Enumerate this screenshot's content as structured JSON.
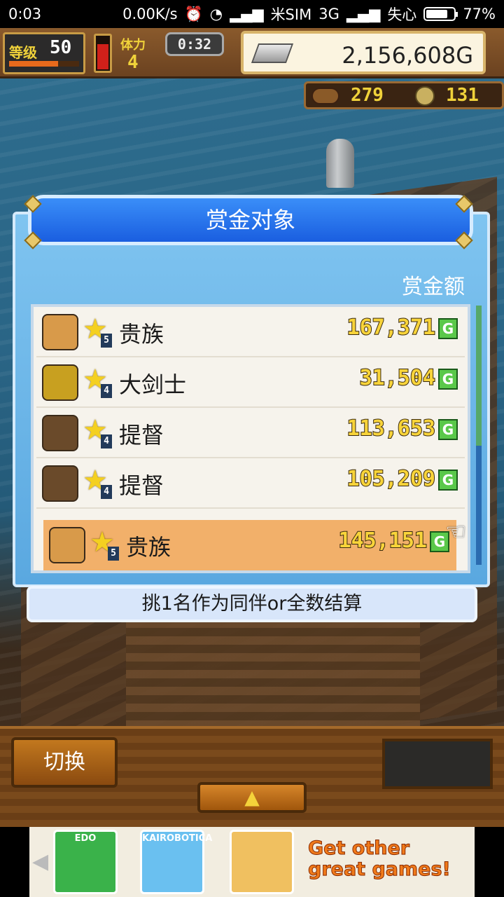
{
  "status_bar": {
    "time": "0:03",
    "network_speed": "0.00K/s",
    "carrier": "米SIM",
    "network_type": "3G",
    "signal_label": "失心",
    "battery_percent": "77%",
    "battery_level": 0.77
  },
  "hud": {
    "level_label": "等级",
    "level_value": "50",
    "level_progress": 0.7,
    "stamina_level": 0.75,
    "stamina_label": "体力",
    "stamina_value": "4",
    "timer": "0:32",
    "gold": "2,156,608G",
    "resource_1": "279",
    "resource_2": "131",
    "gold_icon": "silver-bar-icon",
    "resource_1_icon": "food-icon",
    "resource_2_icon": "coin-icon"
  },
  "dialog": {
    "title": "赏金对象",
    "column_header": "赏金额",
    "hint": "挑1名作为同伴or全数结算",
    "currency_mark": "G",
    "rows": [
      {
        "job": "贵族",
        "rank": "5",
        "bounty": "167,371",
        "selected": false,
        "color": "#d89a4a"
      },
      {
        "job": "大剑士",
        "rank": "4",
        "bounty": "31,504",
        "selected": false,
        "color": "#c8a020"
      },
      {
        "job": "提督",
        "rank": "4",
        "bounty": "113,653",
        "selected": false,
        "color": "#6a4a2a"
      },
      {
        "job": "提督",
        "rank": "4",
        "bounty": "105,209",
        "selected": false,
        "color": "#6a4a2a"
      },
      {
        "job": "贵族",
        "rank": "5",
        "bounty": "145,151",
        "selected": true,
        "color": "#d89a4a"
      }
    ]
  },
  "controls": {
    "switch_label": "切换",
    "up_label": "▲"
  },
  "ad": {
    "thumb_1": "EDO",
    "thumb_2": "KAIROBOTICA",
    "text_line_1": "Get other",
    "text_line_2": "great games!"
  },
  "colors": {
    "accent_blue": "#1a5ee0",
    "selected_row": "#f2b06a",
    "bounty_text": "#f8d43a"
  }
}
